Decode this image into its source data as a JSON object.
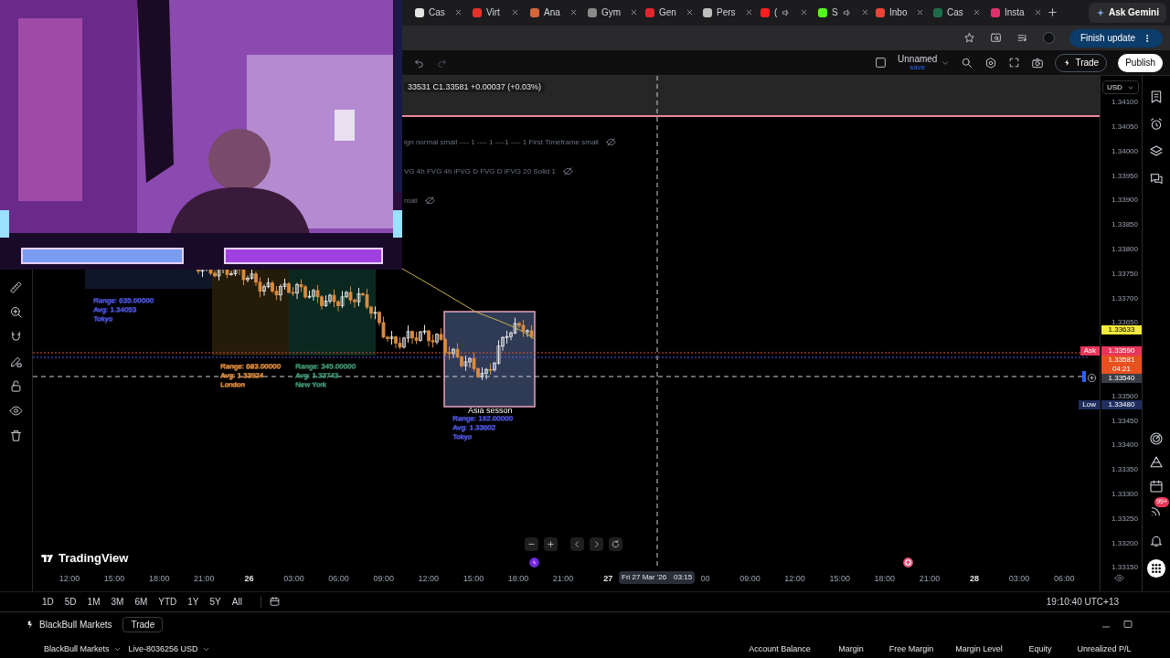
{
  "browser": {
    "tabs": [
      {
        "label": "Cas",
        "color": "#e5e5e5",
        "audio": false,
        "selected": false
      },
      {
        "label": "Virt",
        "color": "#e5322d",
        "audio": false,
        "selected": false
      },
      {
        "label": "Ana",
        "color": "#d9653b",
        "audio": false,
        "selected": false
      },
      {
        "label": "Gym",
        "color": "#8a8a8a",
        "audio": false,
        "selected": false
      },
      {
        "label": "Gen",
        "color": "#e0262f",
        "audio": false,
        "selected": false
      },
      {
        "label": "Pers",
        "color": "#bdbdbd",
        "audio": false,
        "selected": false
      },
      {
        "label": "(",
        "color": "#ff1f1f",
        "audio": true,
        "selected": false
      },
      {
        "label": "S",
        "color": "#53fc18",
        "audio": true,
        "selected": false
      },
      {
        "label": "Inbo",
        "color": "#ea4335",
        "audio": false,
        "selected": false
      },
      {
        "label": "Cas",
        "color": "#1e6b4a",
        "audio": false,
        "selected": false
      },
      {
        "label": "Insta",
        "color": "#e1306c",
        "audio": false,
        "selected": false
      }
    ],
    "ask_button": "Ask Gemini",
    "update_button": "Finish update"
  },
  "toolbar": {
    "layout_name": "Unnamed",
    "save_label": "save",
    "trade_button": "Trade",
    "publish_button": "Publish"
  },
  "legend": {
    "ohlc": "33531 C1.33581 +0.00037 (+0.03%)",
    "indicators": [
      "ign normal small ---- 1 ---- 1 ----1 ---- 1 First Timeframe small",
      "VG 4h FVG 4h iFVG D FVG D iFVG 20 Solid 1",
      "mall"
    ]
  },
  "sessions": [
    {
      "range": "Range: 635.00000",
      "avg": "Avg: 1.34053",
      "name": "Tokyo",
      "color": "#4b52d6"
    },
    {
      "range": "Range: 683.00000",
      "avg": "Avg: 1.33924",
      "name": "London",
      "color": "#d98a3d"
    },
    {
      "range": "Range: 345.00000",
      "avg": "Avg: 1.33743",
      "name": "New York",
      "color": "#3f8f6e"
    },
    {
      "title": "Asia sesson",
      "range": "Range: 192.00000",
      "avg": "Avg: 1.33602",
      "name": "Tokyo",
      "color": "#4b52d6"
    }
  ],
  "price_axis": {
    "currency": "USD",
    "ticks": [
      "1.34100",
      "1.34050",
      "1.34000",
      "1.33950",
      "1.33900",
      "1.33850",
      "1.33800",
      "1.33750",
      "1.33700",
      "1.33650",
      "1.33500",
      "1.33450",
      "1.33400",
      "1.33350",
      "1.33300",
      "1.33250",
      "1.33200",
      "1.33150"
    ],
    "tags": [
      {
        "kind": "last",
        "value": "1.33633",
        "color": "#f5ea3c"
      },
      {
        "kind": "ask",
        "label": "Ask",
        "value": "1.33590",
        "color": "#e8365a"
      },
      {
        "kind": "countdown",
        "value": "1.33581",
        "time": "04:21",
        "color": "#e8501e"
      },
      {
        "kind": "crosshair",
        "value": "1.33540",
        "color": "#3a3d45"
      },
      {
        "kind": "low",
        "label": "Low",
        "value": "1.33480",
        "color": "#1f2e5e"
      }
    ]
  },
  "time_axis": {
    "labels": [
      {
        "text": "12:00",
        "kind": "time"
      },
      {
        "text": "15:00",
        "kind": "time"
      },
      {
        "text": "18:00",
        "kind": "time"
      },
      {
        "text": "21:00",
        "kind": "time"
      },
      {
        "text": "26",
        "kind": "day"
      },
      {
        "text": "03:00",
        "kind": "time"
      },
      {
        "text": "06:00",
        "kind": "time"
      },
      {
        "text": "09:00",
        "kind": "time"
      },
      {
        "text": "12:00",
        "kind": "time"
      },
      {
        "text": "15:00",
        "kind": "time"
      },
      {
        "text": "18:00",
        "kind": "time"
      },
      {
        "text": "21:00",
        "kind": "time"
      },
      {
        "text": "27",
        "kind": "day"
      },
      {
        "text": "00",
        "kind": "time"
      },
      {
        "text": "09:00",
        "kind": "time"
      },
      {
        "text": "12:00",
        "kind": "time"
      },
      {
        "text": "15:00",
        "kind": "time"
      },
      {
        "text": "18:00",
        "kind": "time"
      },
      {
        "text": "21:00",
        "kind": "time"
      },
      {
        "text": "28",
        "kind": "day"
      },
      {
        "text": "03:00",
        "kind": "time"
      },
      {
        "text": "06:00",
        "kind": "time"
      }
    ],
    "crosshair_date": "Fri 27 Mar '26",
    "crosshair_time": "03:15"
  },
  "logo": "TradingView",
  "range_bar": {
    "buttons": [
      "1D",
      "5D",
      "1M",
      "3M",
      "6M",
      "YTD",
      "1Y",
      "5Y",
      "All"
    ],
    "clock": "19:10:40 UTC+13"
  },
  "sidebar": {
    "badge": "99+"
  },
  "panel": {
    "broker": "BlackBull Markets",
    "trade_button": "Trade",
    "account": "BlackBull Markets",
    "live_account": "Live-8036256 USD",
    "columns": [
      "Account Balance",
      "Margin",
      "Free Margin",
      "Margin Level",
      "Equity",
      "Unrealized P/L"
    ]
  }
}
